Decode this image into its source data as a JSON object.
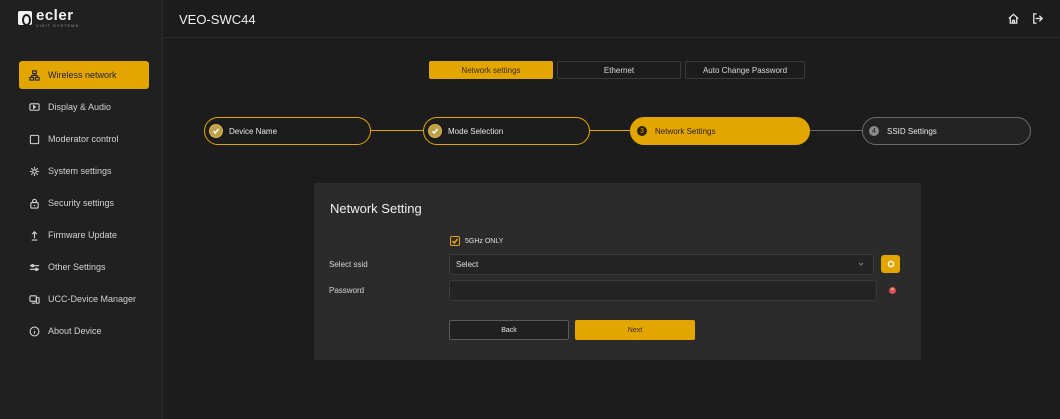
{
  "brand": {
    "name": "ecler",
    "tagline": "VISIT SYSTEMS"
  },
  "header": {
    "title": "VEO-SWC44",
    "icons": [
      "home-icon",
      "logout-icon"
    ]
  },
  "sidebar": {
    "items": [
      {
        "label": "Wireless network",
        "icon": "network-icon",
        "active": true
      },
      {
        "label": "Display & Audio",
        "icon": "display-icon",
        "active": false
      },
      {
        "label": "Moderator control",
        "icon": "square-icon",
        "active": false
      },
      {
        "label": "System settings",
        "icon": "gear-icon",
        "active": false
      },
      {
        "label": "Security settings",
        "icon": "lock-icon",
        "active": false
      },
      {
        "label": "Firmware Update",
        "icon": "upload-icon",
        "active": false
      },
      {
        "label": "Other Settings",
        "icon": "sliders-icon",
        "active": false
      },
      {
        "label": "UCC-Device Manager",
        "icon": "devices-icon",
        "active": false
      },
      {
        "label": "About Device",
        "icon": "info-icon",
        "active": false
      }
    ]
  },
  "tabs": [
    {
      "label": "Network settings",
      "active": true
    },
    {
      "label": "Ethernet",
      "active": false
    },
    {
      "label": "Auto Change Password",
      "active": false
    }
  ],
  "stepper": {
    "steps": [
      {
        "label": "Device Name",
        "state": "done"
      },
      {
        "label": "Mode Selection",
        "state": "done"
      },
      {
        "label": "Network Settings",
        "state": "current",
        "number": "3"
      },
      {
        "label": "SSID Settings",
        "state": "pending",
        "number": "4"
      }
    ]
  },
  "panel": {
    "title": "Network Setting",
    "checkbox": {
      "label": "5GHz ONLY",
      "checked": true
    },
    "ssid": {
      "label": "Select ssid",
      "value": "Select"
    },
    "password": {
      "label": "Password",
      "value": ""
    },
    "back_label": "Back",
    "next_label": "Next"
  },
  "colors": {
    "accent": "#e3a600",
    "background": "#1c1c1c",
    "panel": "#2b2b2b",
    "error": "#d9534f"
  }
}
